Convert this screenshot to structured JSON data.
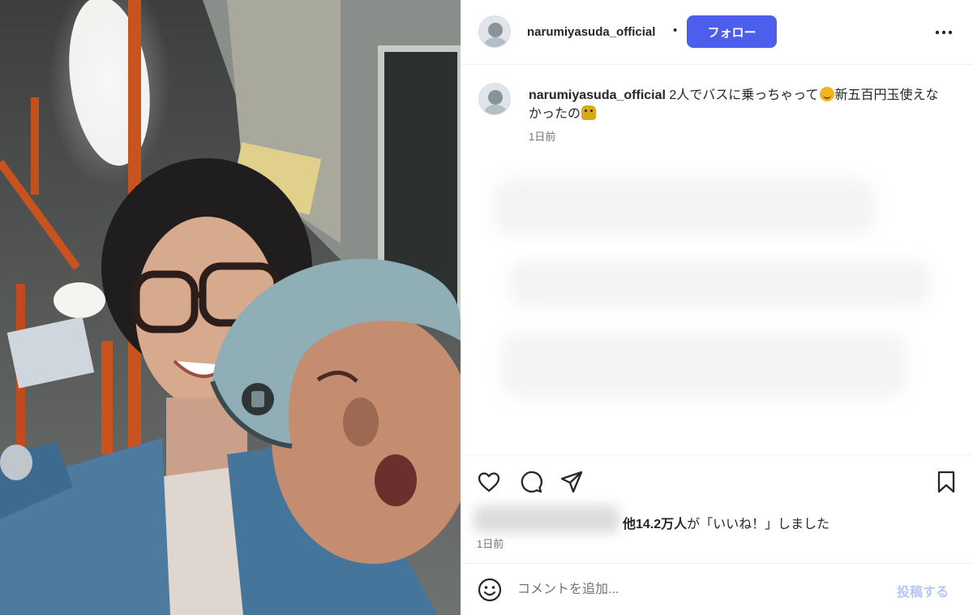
{
  "post": {
    "username": "narumiyasuda_official",
    "separator": "•",
    "follow_label": "フォロー"
  },
  "caption": {
    "username": "narumiyasuda_official",
    "text_part1": " 2人でバスに乗っちゃって",
    "text_part2": "新五百円玉使えなかったの",
    "emoji_1": "smiling-face-emoji",
    "emoji_2": "sweating-face-emoji",
    "time": "1日前"
  },
  "likes": {
    "count_text": "他14.2万人",
    "suffix": "が「いいね！」しました"
  },
  "post_time": "1日前",
  "comment": {
    "placeholder": "コメントを追加...",
    "post_label": "投稿する"
  },
  "icons": {
    "more": "more-options-icon",
    "like": "heart-icon",
    "comment": "comment-icon",
    "share": "share-icon",
    "save": "bookmark-icon",
    "emoji": "emoji-icon"
  },
  "colors": {
    "follow_button": "#4c5fec",
    "post_button_disabled": "#b3c7f7",
    "muted_text": "#737373"
  }
}
